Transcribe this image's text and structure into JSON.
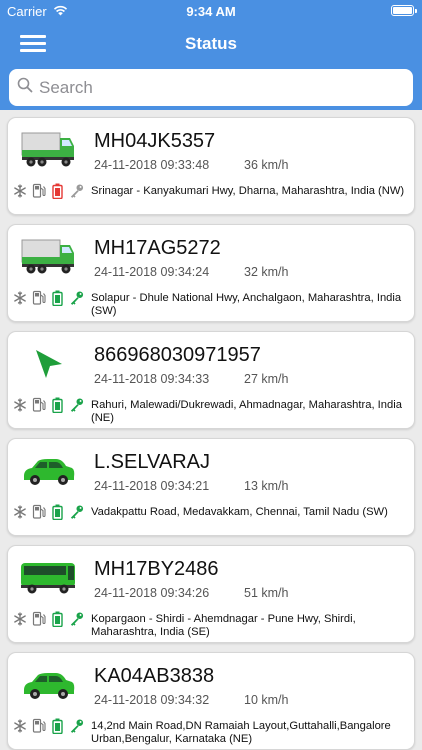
{
  "status_bar": {
    "carrier": "Carrier",
    "time": "9:34 AM"
  },
  "header": {
    "title": "Status"
  },
  "search": {
    "placeholder": "Search"
  },
  "colors": {
    "nav_blue": "#4a90e2",
    "vehicle_green": "#3cb043",
    "ignition_on": "#1aa34a",
    "ignition_off": "#9a9a9a",
    "battery_low": "#e53935",
    "battery_ok": "#1aa34a"
  },
  "vehicles": [
    {
      "type": "truck-icon",
      "plate": "MH04JK5357",
      "datetime": "24-11-2018 09:33:48",
      "speed": "36 km/h",
      "address": "Srinagar - Kanyakumari Hwy, Dharna, Maharashtra,  India (NW)",
      "battery": "low",
      "ignition": "off"
    },
    {
      "type": "truck-icon",
      "plate": "MH17AG5272",
      "datetime": "24-11-2018 09:34:24",
      "speed": "32 km/h",
      "address": "Solapur - Dhule National Hwy,  Anchalgaon, Maharashtra,  India (SW)",
      "battery": "ok",
      "ignition": "on"
    },
    {
      "type": "arrow-icon",
      "plate": "866968030971957",
      "datetime": "24-11-2018 09:34:33",
      "speed": "27 km/h",
      "address": "Rahuri, Malewadi/Dukrewadi, Ahmadnagar, Maharashtra,  India (NE)",
      "battery": "ok",
      "ignition": "on"
    },
    {
      "type": "car-icon",
      "plate": "L.SELVARAJ",
      "datetime": "24-11-2018 09:34:21",
      "speed": "13 km/h",
      "address": "Vadakpattu Road, Medavakkam, Chennai, Tamil Nadu (SW)",
      "battery": "ok",
      "ignition": "on"
    },
    {
      "type": "bus-icon",
      "plate": "MH17BY2486",
      "datetime": "24-11-2018 09:34:26",
      "speed": "51 km/h",
      "address": "Kopargaon - Shirdi - Ahemdnagar - Pune Hwy,  Shirdi, Maharashtra,  India (SE)",
      "battery": "ok",
      "ignition": "on"
    },
    {
      "type": "car-icon",
      "plate": "KA04AB3838",
      "datetime": "24-11-2018 09:34:32",
      "speed": "10 km/h",
      "address": "14,2nd Main Road,DN Ramaiah Layout,Guttahalli,Bangalore Urban,Bengalur, Karnataka (NE)",
      "battery": "ok",
      "ignition": "on"
    }
  ]
}
